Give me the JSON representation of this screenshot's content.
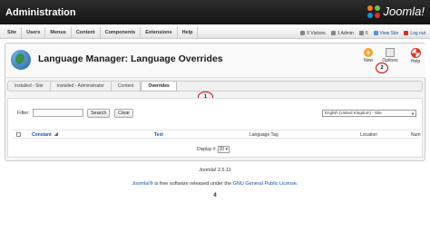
{
  "app": {
    "title": "Administration",
    "logo_text": "Joomla!"
  },
  "menu": [
    "Site",
    "Users",
    "Menus",
    "Content",
    "Components",
    "Extensions",
    "Help"
  ],
  "status": {
    "visitors": "0 Visitors",
    "admins": "1 Admin",
    "messages": "0",
    "view_site": "View Site",
    "logout": "Log out"
  },
  "page": {
    "title": "Language Manager: Language Overrides"
  },
  "toolbar": {
    "new_label": "New",
    "options_label": "Options",
    "help_label": "Help"
  },
  "tabs": [
    {
      "label": "Installed - Site",
      "active": false
    },
    {
      "label": "Installed - Administrator",
      "active": false
    },
    {
      "label": "Content",
      "active": false
    },
    {
      "label": "Overrides",
      "active": true
    }
  ],
  "callouts": [
    "1",
    "2"
  ],
  "filter": {
    "label": "Filter:",
    "value": "",
    "search_button": "Search",
    "clear_button": "Clear",
    "language_select": "English (United Kingdom) - Site"
  },
  "table": {
    "headers": [
      "Constant",
      "Text",
      "Language Tag",
      "Location",
      "Num"
    ]
  },
  "pager": {
    "label": "Display #",
    "value": "20"
  },
  "footer": {
    "version": "Joomla! 2.5.11",
    "license_link1": "Joomla!®",
    "license_mid": " is free software released under the ",
    "license_link2": "GNU General Public License",
    "license_end": "."
  },
  "page_number": "4",
  "colors": {
    "topbar": "#1e1e1e",
    "link": "#1054a6",
    "callout": "#cc0000",
    "new_icon": "#f3a42a"
  }
}
